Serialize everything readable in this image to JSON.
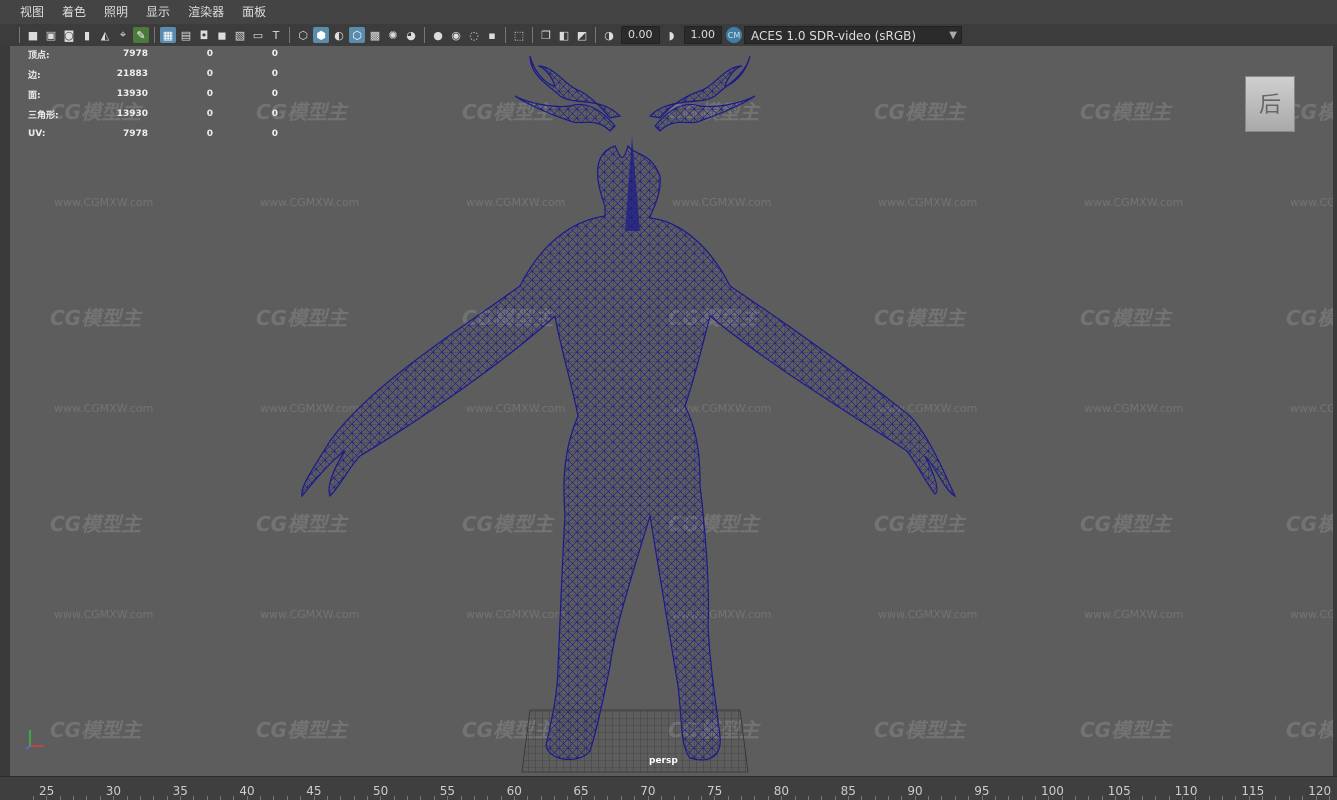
{
  "menu": [
    "视图",
    "着色",
    "照明",
    "显示",
    "渲染器",
    "面板"
  ],
  "toolbar": {
    "icons_group1": [
      "camera-icon",
      "camera-attributes-icon",
      "bookmark-icon",
      "image-plane-icon",
      "2d-pan-zoom-icon",
      "grease-pencil-icon"
    ],
    "icons_group2": [
      "grid-icon",
      "film-gate-icon",
      "resolution-gate-icon",
      "gate-mask-icon",
      "field-chart-icon",
      "safe-action-icon",
      "safe-title-icon"
    ],
    "icons_group3": [
      "wireframe-icon",
      "smooth-shade-icon",
      "default-material-icon",
      "xray-icon",
      "textured-icon",
      "use-all-lights-icon",
      "shadows-icon"
    ],
    "icons_group4": [
      "screen-space-ao-icon",
      "motion-blur-icon",
      "multisample-aa-icon",
      "depth-of-field-icon"
    ],
    "icons_group5": [
      "isolate-select-icon",
      "xray-active-icon",
      "xray-joints-icon",
      "wireframe-on-shaded-icon"
    ],
    "exposure_value": "0.00",
    "gamma_value": "1.00",
    "color_management": "ACES 1.0 SDR-video (sRGB)"
  },
  "hud": {
    "rows": [
      {
        "label": "顶点:",
        "value": "7978",
        "a": "0",
        "b": "0"
      },
      {
        "label": "边:",
        "value": "21883",
        "a": "0",
        "b": "0"
      },
      {
        "label": "面:",
        "value": "13930",
        "a": "0",
        "b": "0"
      },
      {
        "label": "三角形:",
        "value": "13930",
        "a": "0",
        "b": "0"
      },
      {
        "label": "UV:",
        "value": "7978",
        "a": "0",
        "b": "0"
      }
    ]
  },
  "viewcube": {
    "face": "后"
  },
  "camera": {
    "name": "persp"
  },
  "watermark": {
    "logo": "CG模型主",
    "url": "www.CGMXW.com"
  },
  "timeline": {
    "ticks": [
      "25",
      "30",
      "35",
      "40",
      "45",
      "50",
      "55",
      "60",
      "65",
      "70",
      "75",
      "80",
      "85",
      "90",
      "95",
      "100",
      "105",
      "110",
      "115",
      "120"
    ]
  },
  "colors": {
    "wireframe": "#1a1a8c",
    "viewport_bg": "#5d5d5d",
    "accent": "#5a8cae"
  }
}
